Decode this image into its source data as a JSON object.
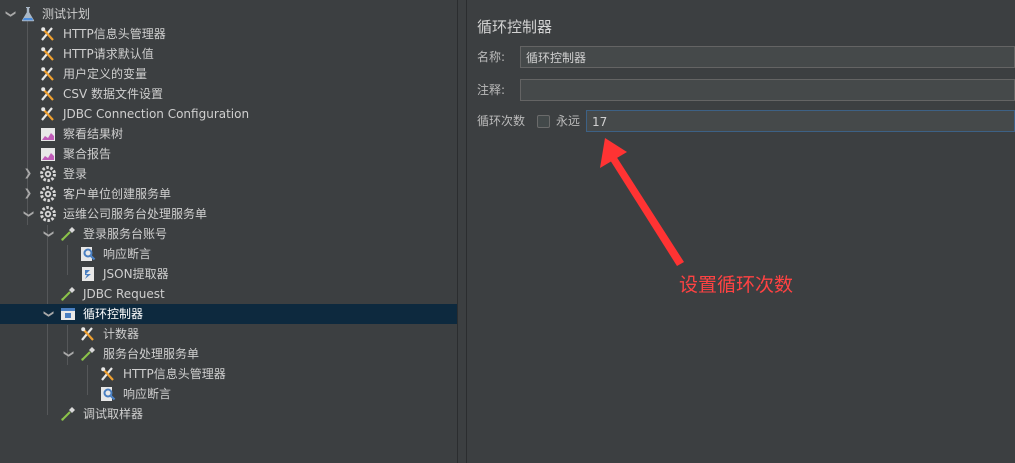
{
  "tree": {
    "items": [
      {
        "label": "测试计划",
        "icon": "flask-icon"
      },
      {
        "label": "HTTP信息头管理器",
        "icon": "wrench-tool-icon"
      },
      {
        "label": "HTTP请求默认值",
        "icon": "wrench-tool-icon"
      },
      {
        "label": "用户定义的变量",
        "icon": "wrench-tool-icon"
      },
      {
        "label": "CSV 数据文件设置",
        "icon": "wrench-tool-icon"
      },
      {
        "label": "JDBC Connection Configuration",
        "icon": "wrench-tool-icon"
      },
      {
        "label": "察看结果树",
        "icon": "chart-icon"
      },
      {
        "label": "聚合报告",
        "icon": "chart-icon"
      },
      {
        "label": "登录",
        "icon": "gear-icon"
      },
      {
        "label": "客户单位创建服务单",
        "icon": "gear-icon"
      },
      {
        "label": "运维公司服务台处理服务单",
        "icon": "gear-icon"
      },
      {
        "label": "登录服务台账号",
        "icon": "pipette-icon"
      },
      {
        "label": "响应断言",
        "icon": "magnifier-icon"
      },
      {
        "label": "JSON提取器",
        "icon": "extractor-icon"
      },
      {
        "label": "JDBC Request",
        "icon": "pipette-icon"
      },
      {
        "label": "循环控制器",
        "icon": "controller-icon"
      },
      {
        "label": "计数器",
        "icon": "wrench-tool-icon"
      },
      {
        "label": "服务台处理服务单",
        "icon": "pipette-icon"
      },
      {
        "label": "HTTP信息头管理器",
        "icon": "wrench-tool-icon"
      },
      {
        "label": "响应断言",
        "icon": "magnifier-icon"
      },
      {
        "label": "调试取样器",
        "icon": "pipette-icon"
      }
    ]
  },
  "panel": {
    "title": "循环控制器",
    "name_label": "名称:",
    "name_value": "循环控制器",
    "comment_label": "注释:",
    "comment_value": "",
    "loop_label": "循环次数",
    "forever_label": "永远",
    "forever_checked": false,
    "loop_value": "17"
  },
  "annotation": {
    "text": "设置循环次数",
    "color": "#ff4242"
  },
  "colors": {
    "background": "#3c3f41",
    "selected_row": "#0d293e",
    "text": "#bbbbbb"
  }
}
